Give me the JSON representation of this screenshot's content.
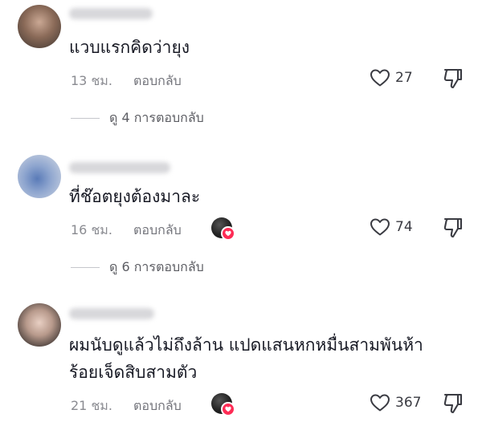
{
  "comments": [
    {
      "text_lines": [
        "แวบแรกคิดว่ายุง"
      ],
      "time": "13 ชม.",
      "reply_label": "ตอบกลับ",
      "likes": "27",
      "view_replies": "ดู 4 การตอบกลับ",
      "creator_liked": false
    },
    {
      "text_lines": [
        "ที่ช๊อตยุงต้องมาละ"
      ],
      "time": "16 ชม.",
      "reply_label": "ตอบกลับ",
      "likes": "74",
      "view_replies": "ดู 6 การตอบกลับ",
      "creator_liked": true
    },
    {
      "text_lines": [
        "ผมนับดูแล้วไม่ถึงล้าน แปดแสนหกหมื่นสามพันห้า",
        "ร้อยเจ็ดสิบสามตัว"
      ],
      "time": "21 ชม.",
      "reply_label": "ตอบกลับ",
      "likes": "367",
      "creator_liked": true
    }
  ],
  "colors": {
    "text": "#161823",
    "meta": "#8a8b91",
    "heart_badge": "#fe2c55"
  },
  "icons": [
    "heart-outline-icon",
    "thumbs-down-icon",
    "creator-heart-badge-icon"
  ]
}
